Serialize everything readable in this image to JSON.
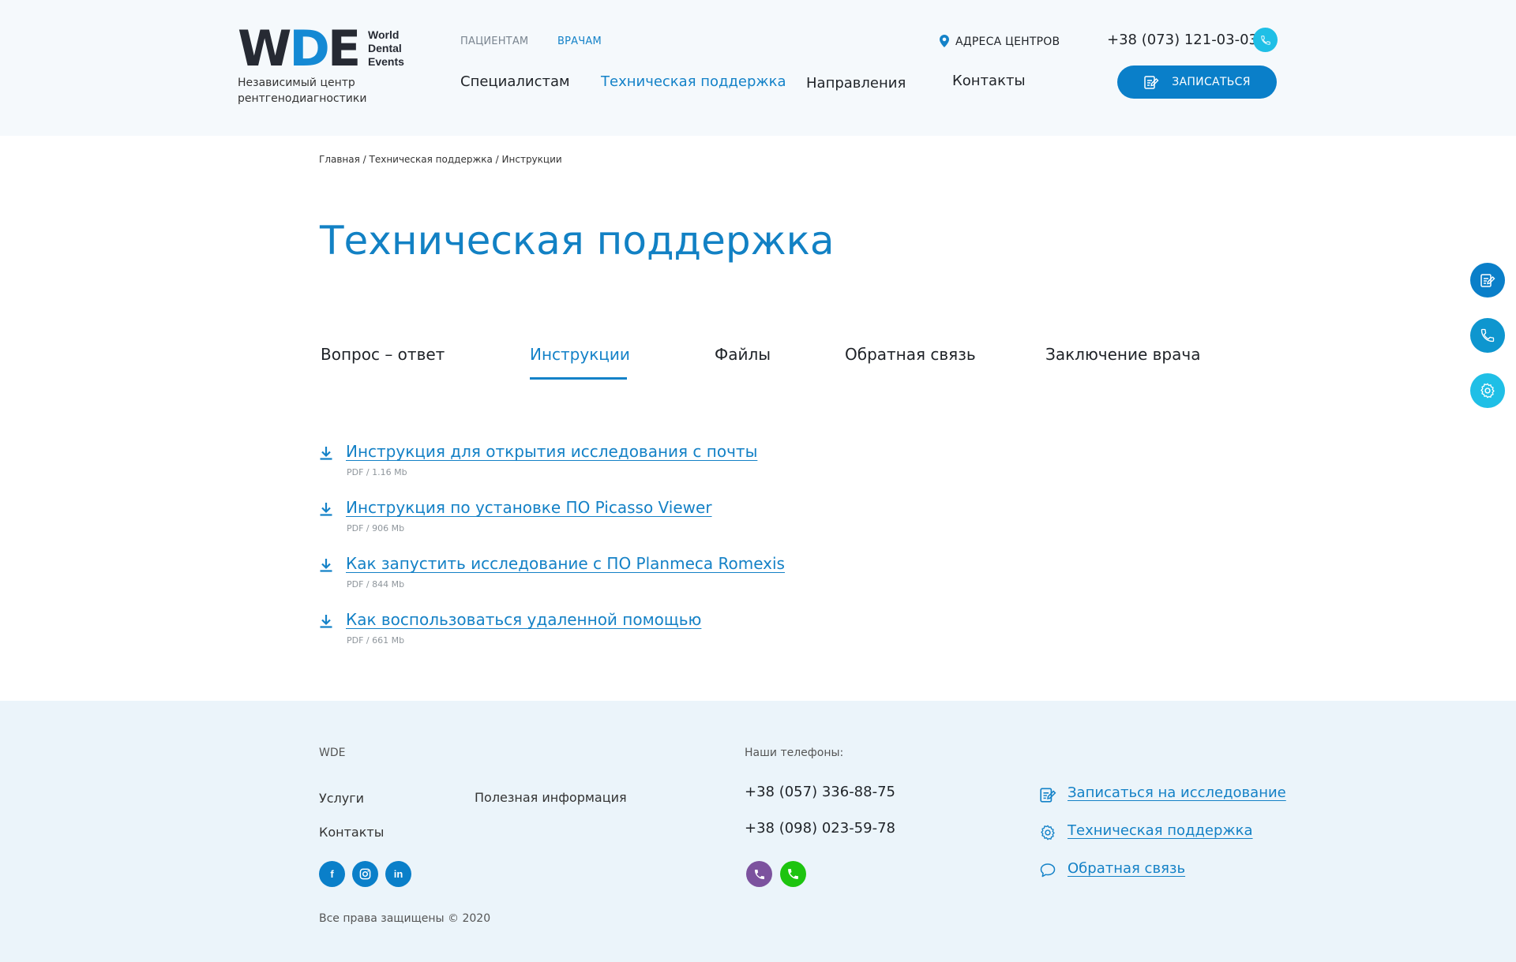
{
  "header": {
    "logo_letters": "WDE",
    "logo_words": [
      "World",
      "Dental",
      "Events"
    ],
    "tagline": "Независимый центр рентгенодиагностики",
    "top_links": [
      "ПАЦИЕНТАМ",
      "ВРАЧАМ"
    ],
    "nav": [
      "Специалистам",
      "Техническая поддержка",
      "Направления",
      "Контакты"
    ],
    "address_label": "АДРЕСА ЦЕНТРОВ",
    "phone": "+38 (073) 121-03-03",
    "signup_label": "ЗАПИСАТЬСЯ"
  },
  "breadcrumb": "Главная / Техническая поддержка / Инструкции",
  "page_title": "Техническая поддержка",
  "tabs": [
    "Вопрос – ответ",
    "Инструкции",
    "Файлы",
    "Обратная связь",
    "Заключение врача"
  ],
  "active_tab": "Инструкции",
  "documents": [
    {
      "title": "Инструкция для открытия исследования с почты",
      "meta": "PDF / 1.16 Mb"
    },
    {
      "title": "Инструкция по установке ПО Picasso Viewer",
      "meta": "PDF / 906 Mb"
    },
    {
      "title": "Как запустить исследование с ПО Planmeca Romexis",
      "meta": "PDF / 844 Mb"
    },
    {
      "title": "Как воспользоваться удаленной помощью",
      "meta": "PDF / 661 Mb"
    }
  ],
  "footer": {
    "brand": "WDE",
    "links": [
      "Услуги",
      "Полезная информация",
      "Контакты"
    ],
    "phones_label": "Наши телефоны:",
    "phones": [
      "+38 (057) 336-88-75",
      "+38 (098) 023-59-78"
    ],
    "actions": [
      "Записаться на исследование",
      "Техническая поддержка",
      "Обратная связь"
    ],
    "copyright": "Все права защищены © 2020"
  },
  "icons": {
    "pin": "map-pin-icon",
    "phone": "phone-icon",
    "signup": "edit-document-icon",
    "download": "download-icon",
    "settings": "gear-icon",
    "chat": "chat-bubble-icon",
    "socials": [
      "facebook-icon",
      "instagram-icon",
      "linkedin-icon"
    ],
    "messengers": [
      "viber-icon",
      "whatsapp-icon"
    ]
  },
  "colors": {
    "accent": "#1482c8",
    "dark_blue": "#0a7fc9",
    "cyan": "#1fbfe6",
    "header_bg": "#f5f9fc",
    "footer_bg": "#ebf4fa",
    "viber": "#7c529e",
    "whatsapp": "#1dc40f"
  }
}
